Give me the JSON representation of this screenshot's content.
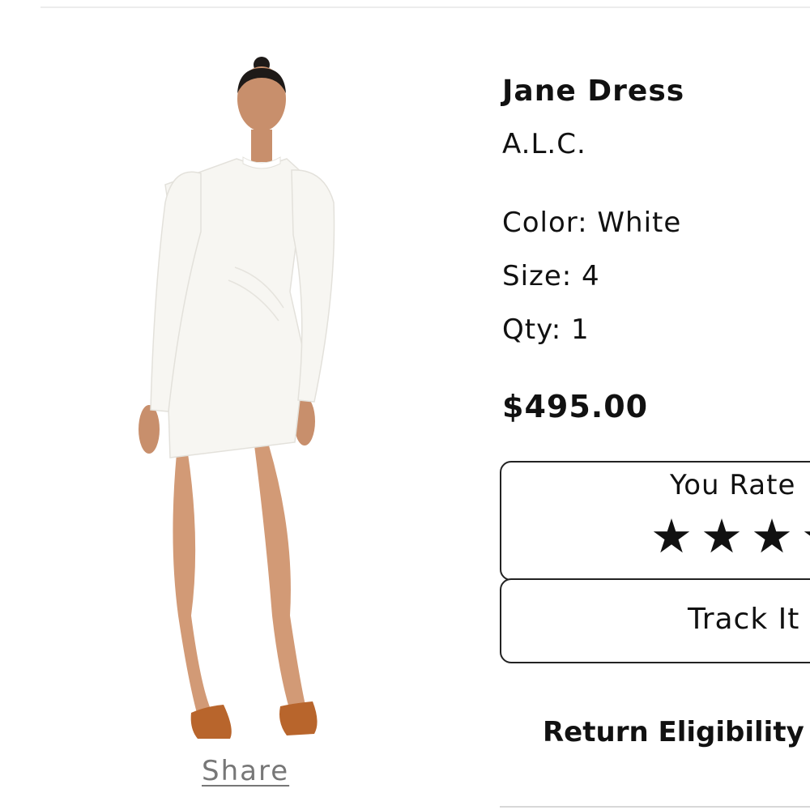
{
  "product": {
    "title": "Jane Dress",
    "brand": "A.L.C.",
    "color": "Color: White",
    "size": "Size: 4",
    "qty": "Qty: 1",
    "price": "$495.00"
  },
  "rating": {
    "label": "You Rate",
    "star_glyph": "★",
    "visible_stars": 3
  },
  "actions": {
    "track_label": "Track It",
    "return_label": "Return Eligibility",
    "share_label": "Share"
  },
  "image": {
    "icon": "dress-model-photo"
  }
}
